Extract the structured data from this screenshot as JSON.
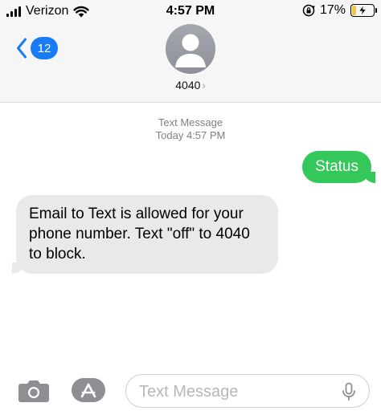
{
  "status_bar": {
    "carrier": "Verizon",
    "time": "4:57 PM",
    "battery_percent": "17%",
    "battery_level": 0.17,
    "charging": true,
    "icons": [
      "signal-icon",
      "wifi-icon",
      "rotation-lock-icon",
      "battery-icon"
    ]
  },
  "nav": {
    "back_badge": "12",
    "contact_name": "4040",
    "contact_chevron": "›"
  },
  "conversation": {
    "meta_label": "Text Message",
    "meta_time": "Today 4:57 PM",
    "messages": [
      {
        "direction": "outgoing",
        "text": "Status"
      },
      {
        "direction": "incoming",
        "text": "Email to Text is allowed for your phone number. Text \"off\" to 4040 to block."
      }
    ]
  },
  "compose": {
    "placeholder": "Text Message",
    "value": ""
  },
  "colors": {
    "accent": "#1a7cf5",
    "outgoing_bubble": "#34c759",
    "incoming_bubble": "#e9e9eb",
    "header_bg": "#f6f6f7"
  }
}
